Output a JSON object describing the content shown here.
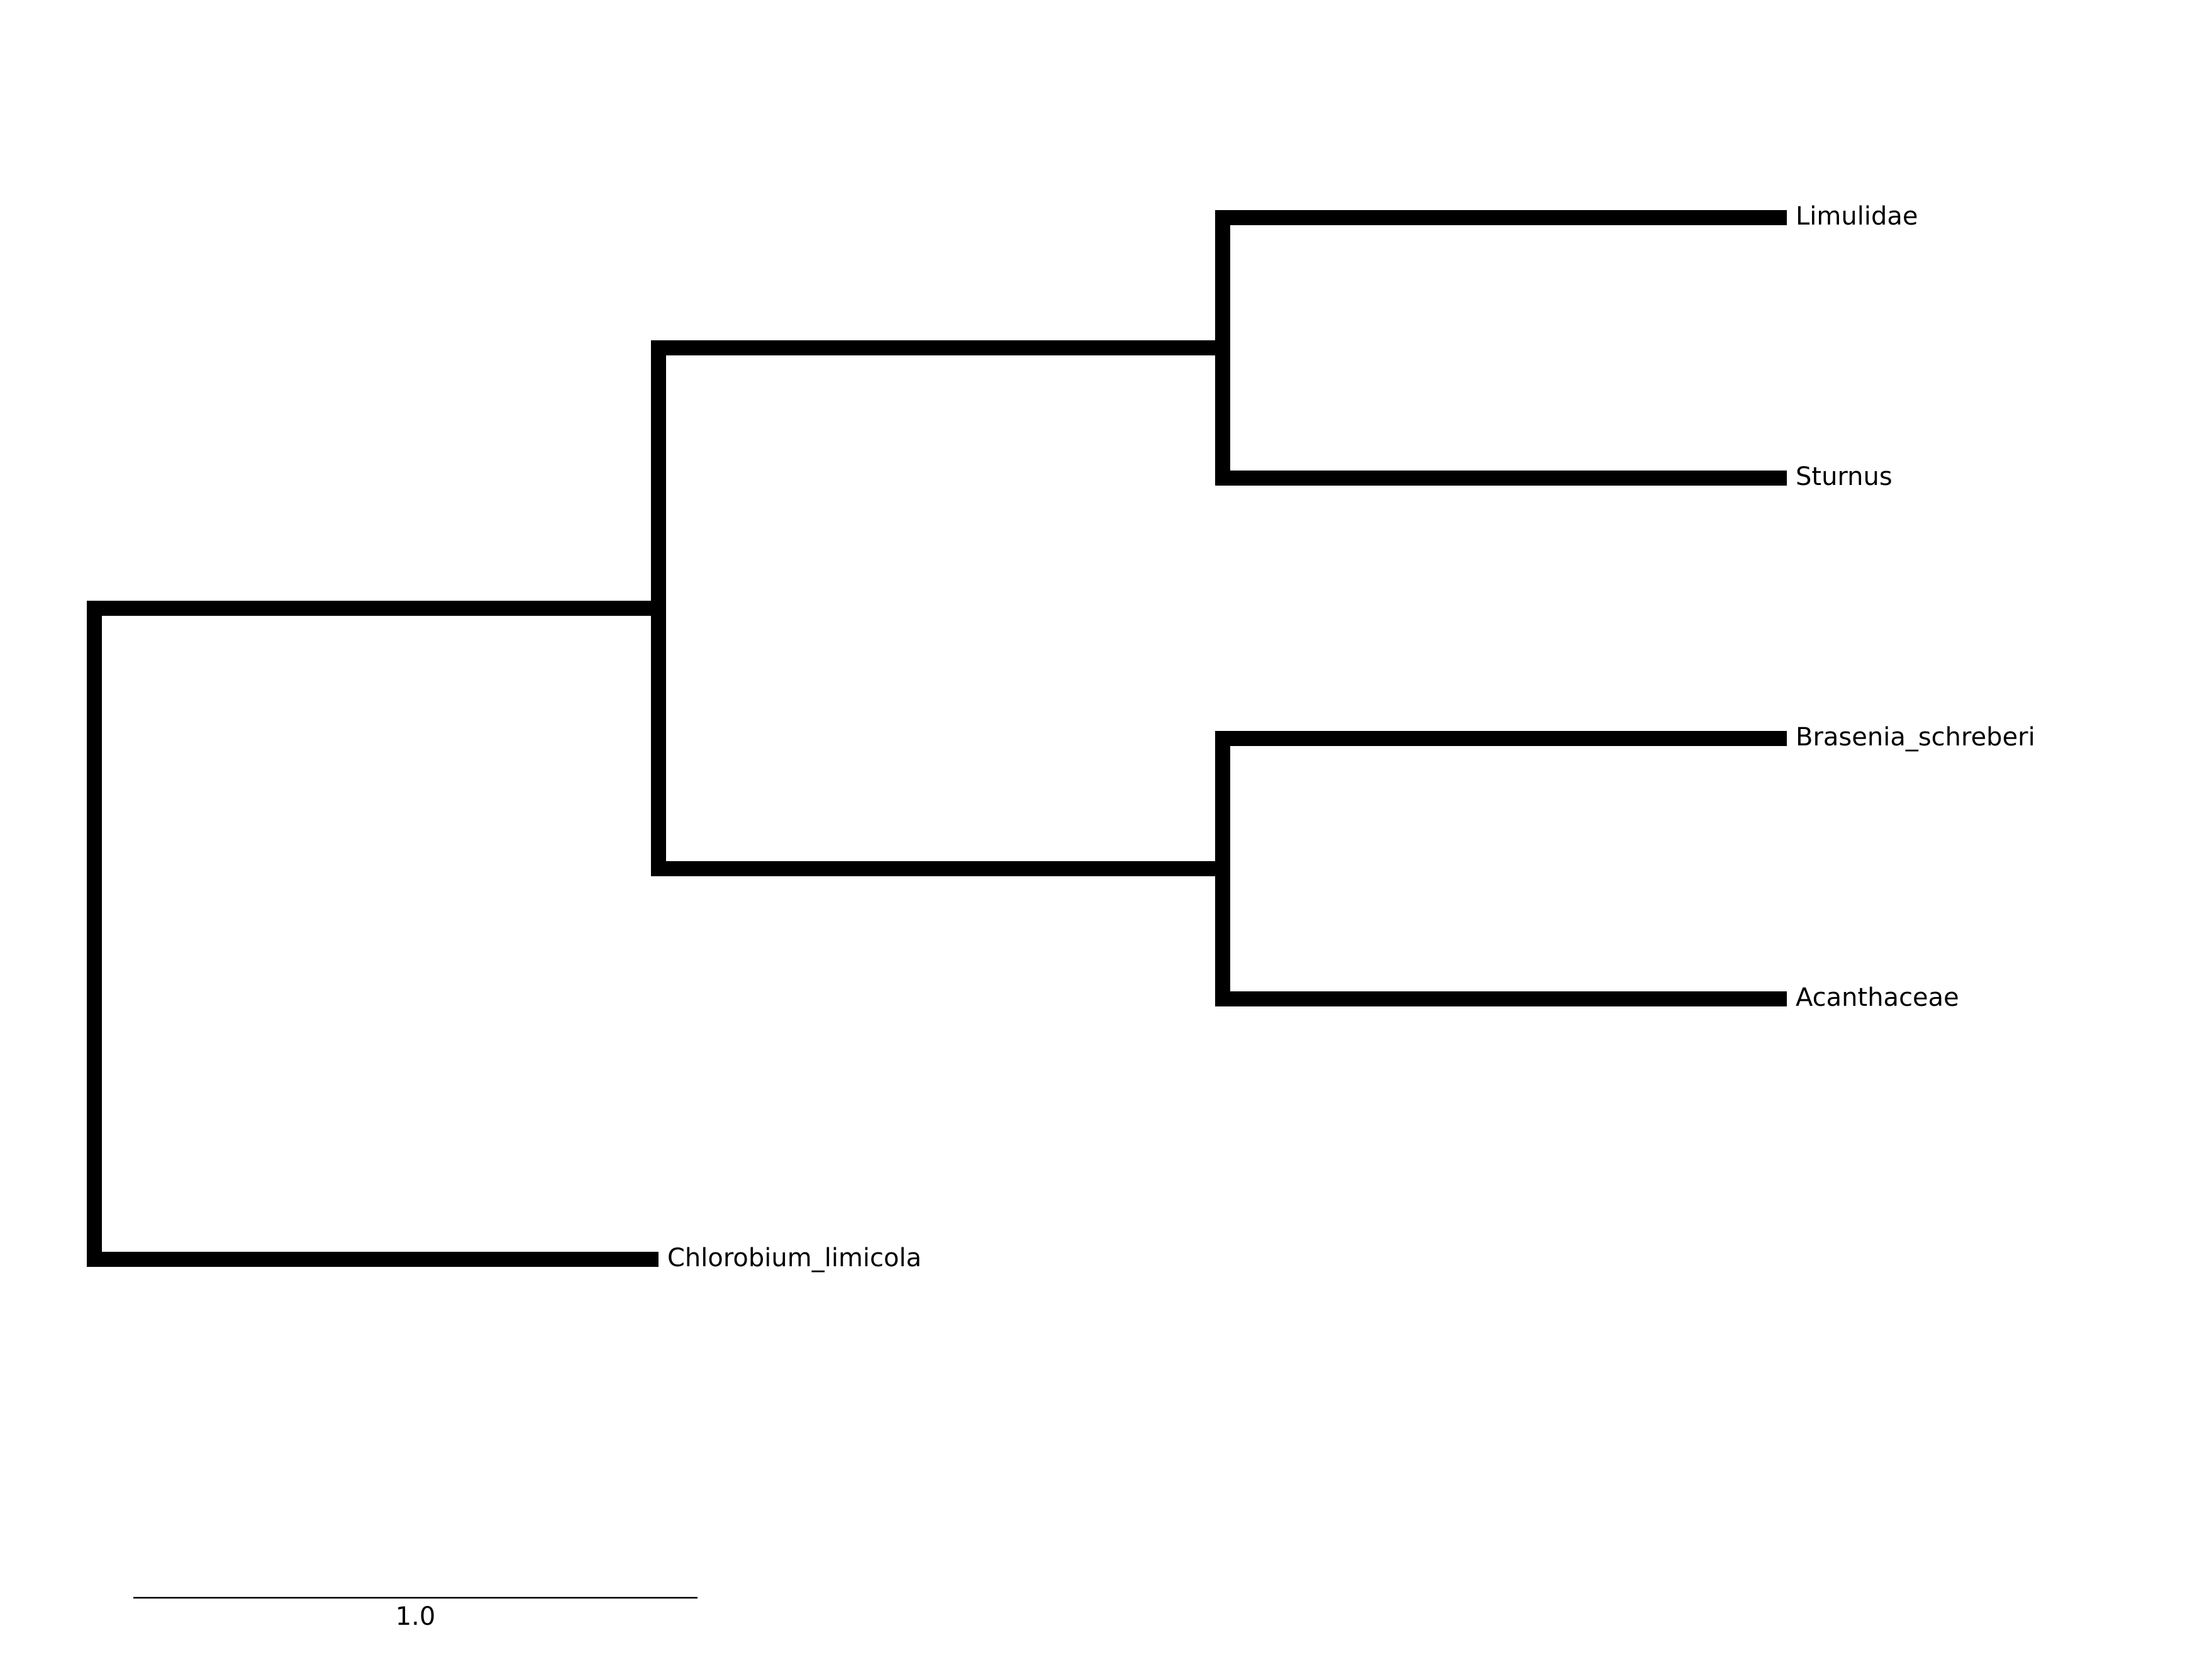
{
  "tree": {
    "root": {
      "children": [
        {
          "branch_length": 1.0,
          "children": [
            {
              "branch_length": 1.0,
              "children": [
                {
                  "branch_length": 1.0,
                  "name": "Limulidae"
                },
                {
                  "branch_length": 1.0,
                  "name": "Sturnus"
                }
              ]
            },
            {
              "branch_length": 1.0,
              "children": [
                {
                  "branch_length": 1.0,
                  "name": "Brasenia_schreberi"
                },
                {
                  "branch_length": 1.0,
                  "name": "Acanthaceae"
                }
              ]
            }
          ]
        },
        {
          "branch_length": 1.0,
          "name": "Chlorobium_limicola"
        }
      ]
    },
    "line_color": "#000000"
  },
  "scale_bar": {
    "length": 1.0,
    "label": "1.0"
  }
}
